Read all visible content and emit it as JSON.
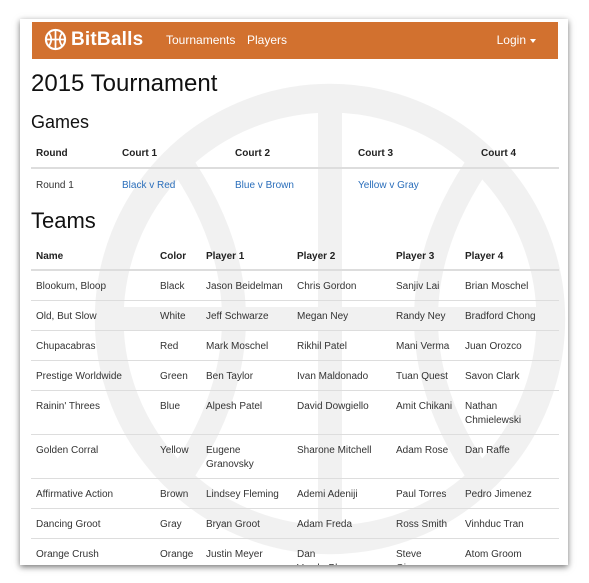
{
  "brand": {
    "name": "BitBalls"
  },
  "nav": {
    "tournaments": "Tournaments",
    "players": "Players",
    "login": "Login"
  },
  "page": {
    "title": "2015 Tournament"
  },
  "games": {
    "title": "Games",
    "headers": [
      "Round",
      "Court 1",
      "Court 2",
      "Court 3",
      "Court 4"
    ],
    "rows": [
      [
        "Round 1",
        "Black v Red",
        "Blue v Brown",
        "Yellow v Gray",
        ""
      ]
    ]
  },
  "teams": {
    "title": "Teams",
    "headers": [
      "Name",
      "Color",
      "Player 1",
      "Player 2",
      "Player 3",
      "Player 4"
    ],
    "rows": [
      [
        "Blookum, Bloop",
        "Black",
        "Jason Beidelman",
        "Chris Gordon",
        "Sanjiv Lai",
        "Brian Moschel"
      ],
      [
        "Old, But Slow",
        "White",
        "Jeff Schwarze",
        "Megan Ney",
        "Randy Ney",
        "Bradford Chong"
      ],
      [
        "Chupacabras",
        "Red",
        "Mark Moschel",
        "Rikhil Patel",
        "Mani Verma",
        "Juan Orozco"
      ],
      [
        "Prestige Worldwide",
        "Green",
        "Ben Taylor",
        "Ivan Maldonado",
        "Tuan Quest",
        "Savon Clark"
      ],
      [
        "Rainin' Threes",
        "Blue",
        "Alpesh Patel",
        "David Dowgiello",
        "Amit Chikani",
        "Nathan Chmielewski"
      ],
      [
        "Golden Corral",
        "Yellow",
        "Eugene Granovsky",
        "Sharone Mitchell",
        "Adam Rose",
        "Dan Raffe"
      ],
      [
        "Affirmative Action",
        "Brown",
        "Lindsey Fleming",
        "Ademi Adeniji",
        "Paul Torres",
        "Pedro Jimenez"
      ],
      [
        "Dancing Groot",
        "Gray",
        "Bryan Groot",
        "Adam Freda",
        "Ross Smith",
        "Vinhduc Tran"
      ],
      [
        "Orange Crush",
        "Orange",
        "Justin Meyer",
        "Dan VanderBloomen",
        "Steve Gianos",
        "Atom Groom"
      ]
    ]
  },
  "colors": {
    "accent": "#d2712f",
    "link": "#2a6ebb"
  },
  "icons": {
    "brand": "basketball-icon",
    "watermark": "basketball-watermark-icon",
    "caret": "caret-down-icon"
  }
}
